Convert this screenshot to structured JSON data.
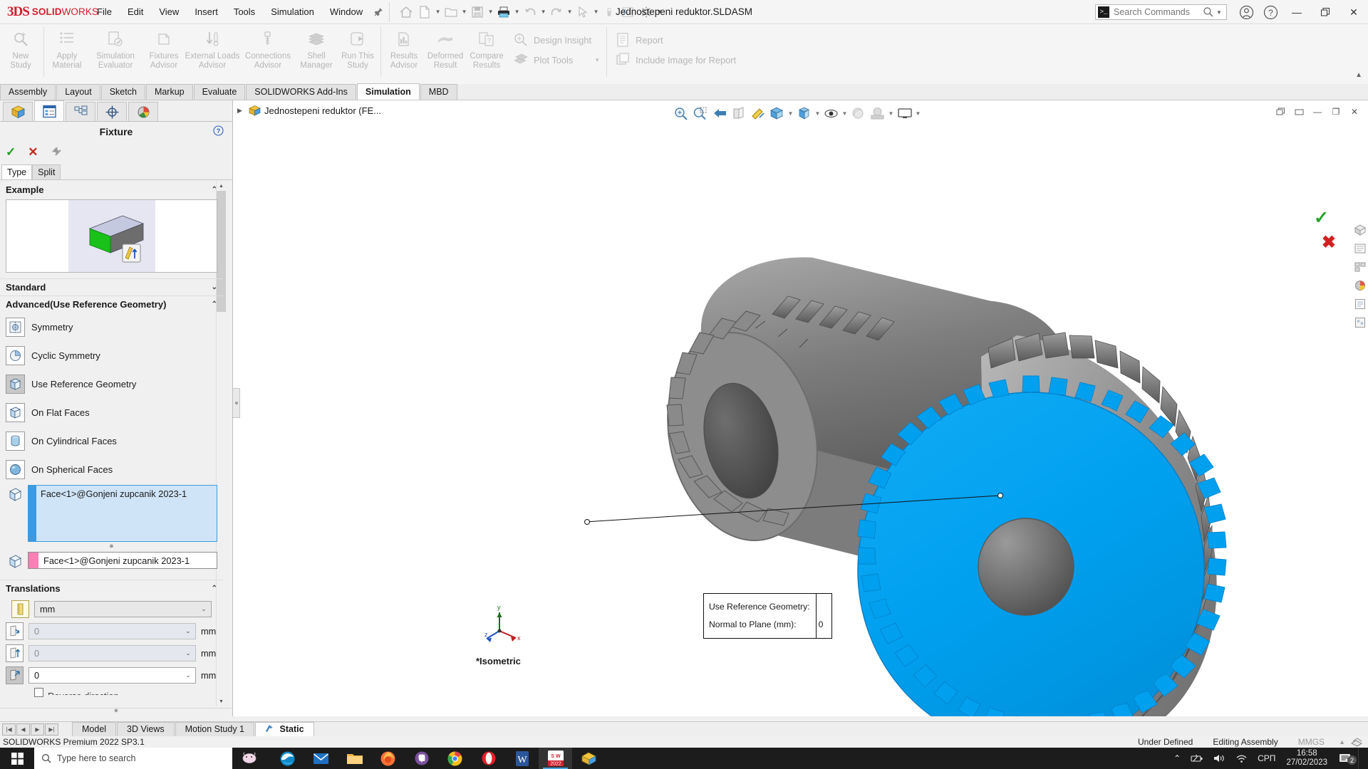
{
  "titlebar": {
    "brand_ds": "3DS",
    "brand_solid": "SOLID",
    "brand_works": "WORKS",
    "menus": [
      "File",
      "Edit",
      "View",
      "Insert",
      "Tools",
      "Simulation",
      "Window"
    ],
    "document_title": "Jednostepeni reduktor.SLDASM",
    "search_placeholder": "Search Commands",
    "minimize": "—",
    "restore": "❐",
    "close": "✕"
  },
  "ribbon": {
    "buttons": [
      {
        "label1": "New",
        "label2": "Study",
        "icon": "new-study-icon"
      },
      {
        "label1": "Apply",
        "label2": "Material",
        "icon": "apply-material-icon"
      },
      {
        "label1": "Simulation",
        "label2": "Evaluator",
        "icon": "simulation-evaluator-icon"
      },
      {
        "label1": "Fixtures",
        "label2": "Advisor",
        "icon": "fixtures-advisor-icon"
      },
      {
        "label1": "External Loads",
        "label2": "Advisor",
        "icon": "external-loads-advisor-icon"
      },
      {
        "label1": "Connections",
        "label2": "Advisor",
        "icon": "connections-advisor-icon"
      },
      {
        "label1": "Shell",
        "label2": "Manager",
        "icon": "shell-manager-icon"
      },
      {
        "label1": "Run This",
        "label2": "Study",
        "icon": "run-this-study-icon"
      },
      {
        "label1": "Results",
        "label2": "Advisor",
        "icon": "results-advisor-icon"
      },
      {
        "label1": "Deformed",
        "label2": "Result",
        "icon": "deformed-result-icon"
      },
      {
        "label1": "Compare",
        "label2": "Results",
        "icon": "compare-results-icon"
      }
    ],
    "side_items": [
      {
        "label": "Design Insight",
        "icon": "design-insight-icon",
        "caret": false
      },
      {
        "label": "Plot Tools",
        "icon": "plot-tools-icon",
        "caret": true
      }
    ],
    "report_items": [
      {
        "label": "Report",
        "icon": "report-icon"
      },
      {
        "label": "Include Image for Report",
        "icon": "include-image-icon"
      }
    ]
  },
  "command_tabs": [
    {
      "label": "Assembly",
      "active": false
    },
    {
      "label": "Layout",
      "active": false
    },
    {
      "label": "Sketch",
      "active": false
    },
    {
      "label": "Markup",
      "active": false
    },
    {
      "label": "Evaluate",
      "active": false
    },
    {
      "label": "SOLIDWORKS Add-Ins",
      "active": false
    },
    {
      "label": "Simulation",
      "active": true
    },
    {
      "label": "MBD",
      "active": false
    }
  ],
  "property_manager": {
    "tabs": [
      "feature-tree-tab",
      "property-manager-tab",
      "configuration-tab",
      "display-manager-tab",
      "appearances-tab"
    ],
    "title": "Fixture",
    "actions": {
      "ok": "✓",
      "cancel": "✕",
      "pin": "pin-icon"
    },
    "type_tab": "Type",
    "split_tab": "Split",
    "sections": {
      "example": "Example",
      "standard": "Standard",
      "advanced": "Advanced(Use Reference Geometry)",
      "translations": "Translations"
    },
    "fixture_types": [
      {
        "label": "Symmetry",
        "icon": "symmetry-icon",
        "selected": false
      },
      {
        "label": "Cyclic Symmetry",
        "icon": "cyclic-symmetry-icon",
        "selected": false
      },
      {
        "label": "Use Reference Geometry",
        "icon": "use-reference-geometry-icon",
        "selected": true
      },
      {
        "label": "On Flat Faces",
        "icon": "on-flat-faces-icon",
        "selected": false
      },
      {
        "label": "On Cylindrical Faces",
        "icon": "on-cylindrical-faces-icon",
        "selected": false
      },
      {
        "label": "On Spherical Faces",
        "icon": "on-spherical-faces-icon",
        "selected": false
      }
    ],
    "selection_face": "Face<1>@Gonjeni zupcanik 2023-1",
    "reference_face": "Face<1>@Gonjeni zupcanik 2023-1",
    "units": "mm",
    "translations": [
      {
        "value": "0",
        "unit": "mm",
        "enabled": false,
        "icon": "translation-along-plane-1-icon"
      },
      {
        "value": "0",
        "unit": "mm",
        "enabled": false,
        "icon": "translation-along-plane-2-icon"
      },
      {
        "value": "0",
        "unit": "mm",
        "enabled": true,
        "icon": "translation-normal-to-plane-icon"
      }
    ],
    "reverse_direction": "Reverse direction"
  },
  "graphics": {
    "tree_root": "Jednostepeni reduktor (FE...",
    "heads_up_icons": [
      "zoom-to-fit-icon",
      "zoom-to-area-icon",
      "previous-view-icon",
      "section-view-icon",
      "measure-icon",
      "view-orientation-icon",
      "display-style-icon",
      "hide-show-icon",
      "apply-scene-icon",
      "view-settings-icon",
      "display-state-icon"
    ],
    "callout": {
      "line1": "Use Reference Geometry:",
      "line2": "Normal to Plane (mm):",
      "value": "0"
    },
    "view_label": "*Isometric",
    "triad_axes": {
      "x": "x",
      "y": "y",
      "z": "z"
    },
    "selected_face_color": "#00a2f0",
    "gear_color": "#8c8c8c"
  },
  "bottom_tabs": [
    {
      "label": "Model",
      "active": false
    },
    {
      "label": "3D Views",
      "active": false
    },
    {
      "label": "Motion Study 1",
      "active": false
    },
    {
      "label": "Static",
      "active": true
    }
  ],
  "status": {
    "version": "SOLIDWORKS Premium 2022 SP3.1",
    "state": "Under Defined",
    "mode": "Editing Assembly",
    "units": "MMGS"
  },
  "taskbar": {
    "search_placeholder": "Type here to search",
    "apps": [
      {
        "name": "edge-app",
        "active": false
      },
      {
        "name": "mail-app",
        "active": false
      },
      {
        "name": "file-explorer-app",
        "active": false
      },
      {
        "name": "firefox-app",
        "active": false
      },
      {
        "name": "viber-app",
        "active": false
      },
      {
        "name": "chrome-app",
        "active": false
      },
      {
        "name": "opera-app",
        "active": false
      },
      {
        "name": "word-app",
        "active": false
      },
      {
        "name": "solidworks-app",
        "active": true
      },
      {
        "name": "solidworks-doc-app",
        "active": false
      }
    ],
    "language": "СРП",
    "time": "16:58",
    "date": "27/02/2023",
    "notification_count": "2"
  }
}
